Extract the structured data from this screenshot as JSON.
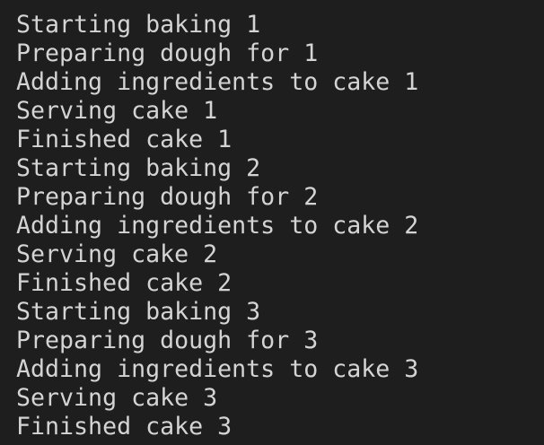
{
  "terminal": {
    "lines": [
      "Starting baking 1",
      "Preparing dough for 1",
      "Adding ingredients to cake 1",
      "Serving cake 1",
      "Finished cake 1",
      "Starting baking 2",
      "Preparing dough for 2",
      "Adding ingredients to cake 2",
      "Serving cake 2",
      "Finished cake 2",
      "Starting baking 3",
      "Preparing dough for 3",
      "Adding ingredients to cake 3",
      "Serving cake 3",
      "Finished cake 3"
    ]
  },
  "colors": {
    "background": "#1e1e1e",
    "text": "#d4d4d4"
  }
}
